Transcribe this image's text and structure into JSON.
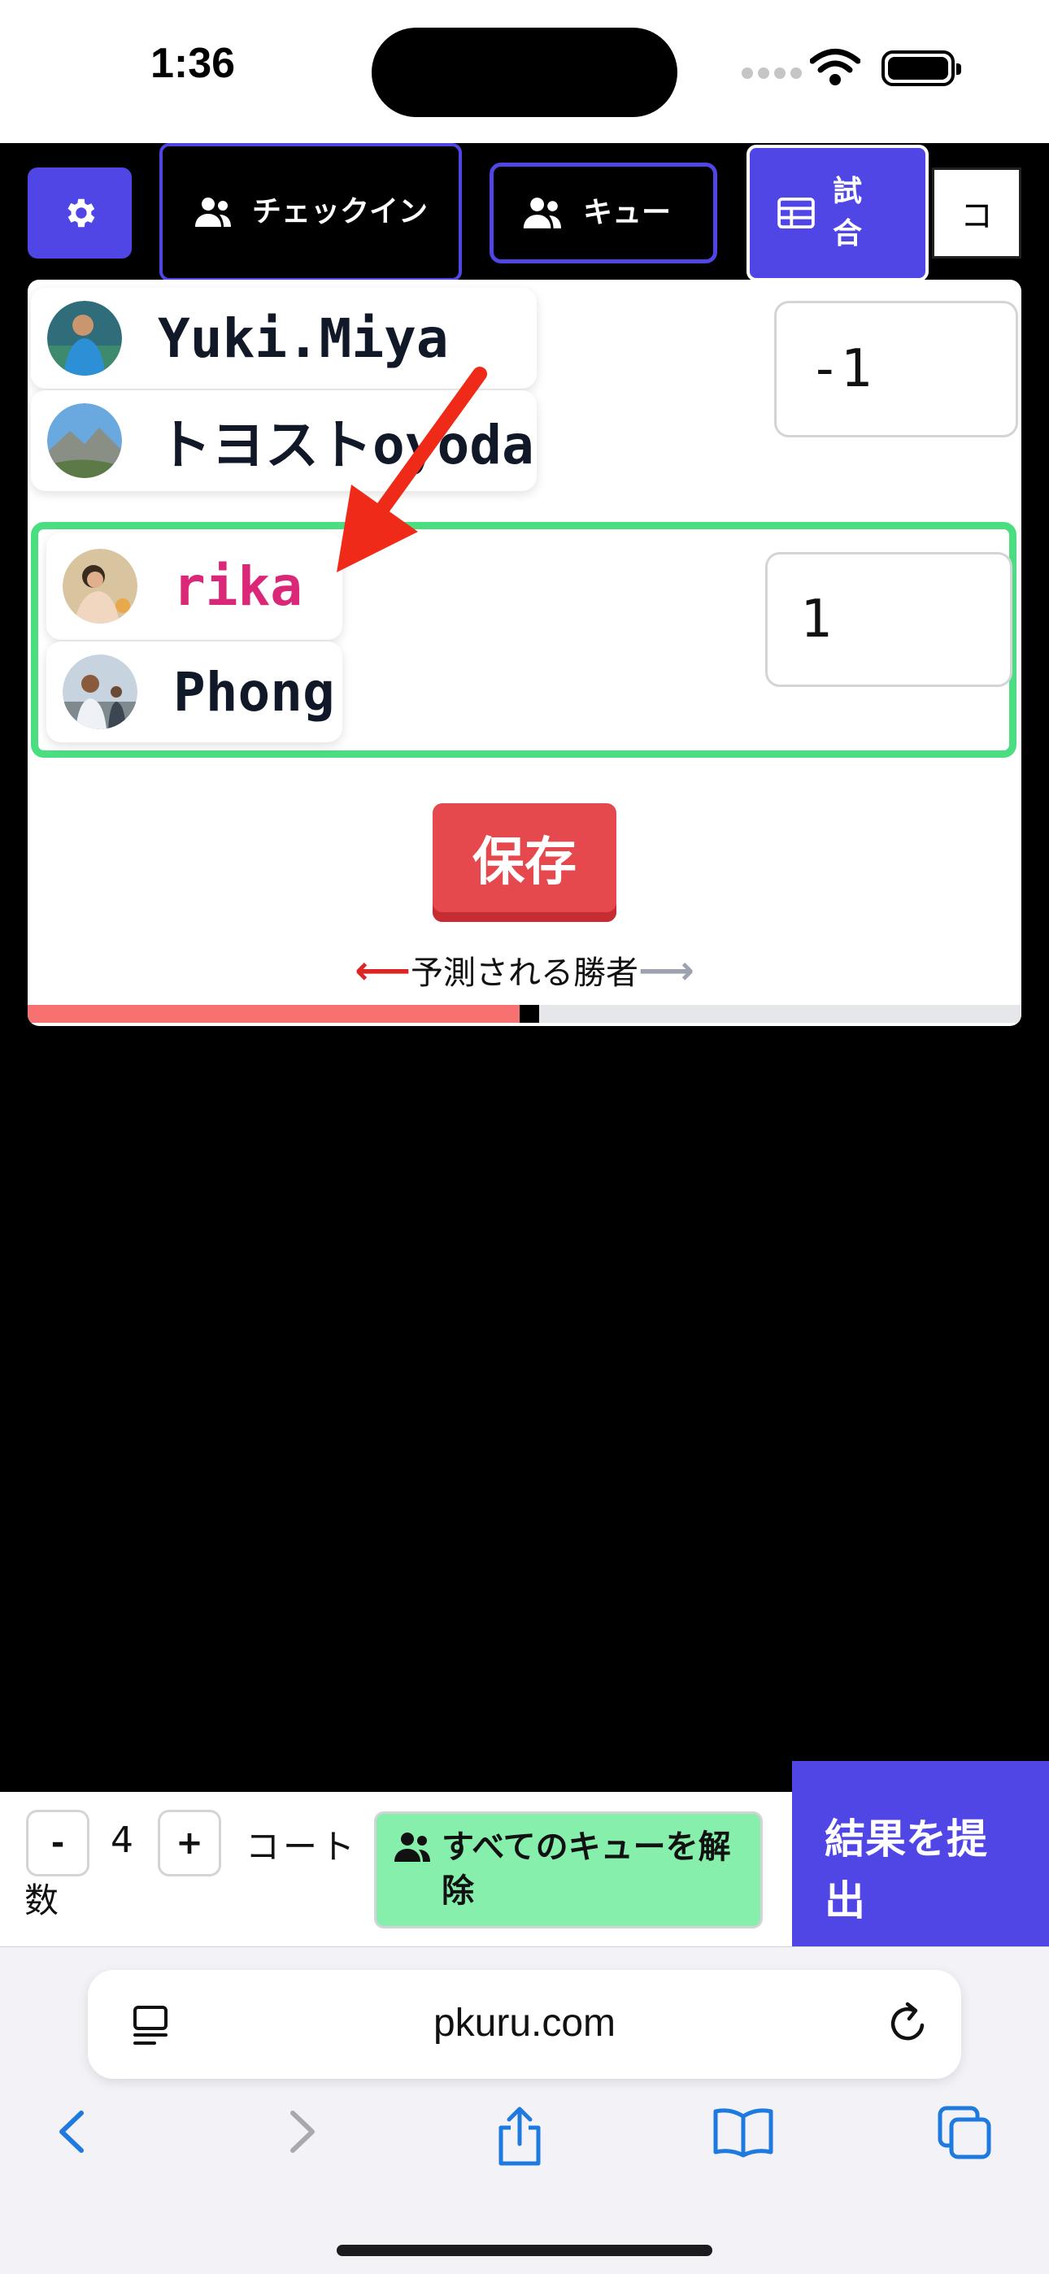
{
  "status_bar": {
    "time": "1:36"
  },
  "toolbar": {
    "checkin_label": "チェックイン",
    "queue_label": "キュー",
    "match_label": "試合",
    "court_tab_label": "コ"
  },
  "match": {
    "team1": {
      "players": [
        "Yuki.Miya",
        "トヨストoyoda"
      ],
      "score": "-1"
    },
    "team2": {
      "players": [
        "rika",
        "Phong"
      ],
      "score": "1"
    },
    "save_label": "保存",
    "predicted_winner_label": "予測される勝者",
    "win_probability_team1": 0.5
  },
  "bottom_bar": {
    "minus": "-",
    "court_count": "4",
    "plus": "+",
    "court_label_1": "コート",
    "court_label_2": "数",
    "clear_queue_label": "すべてのキューを解除",
    "submit_label": "結果を提出"
  },
  "browser": {
    "url": "pkuru.com"
  },
  "colors": {
    "accent": "#4f46e5",
    "highlight": "#4ade80",
    "save": "#e5484d",
    "clear": "#86efac",
    "female_name": "#db2777"
  }
}
